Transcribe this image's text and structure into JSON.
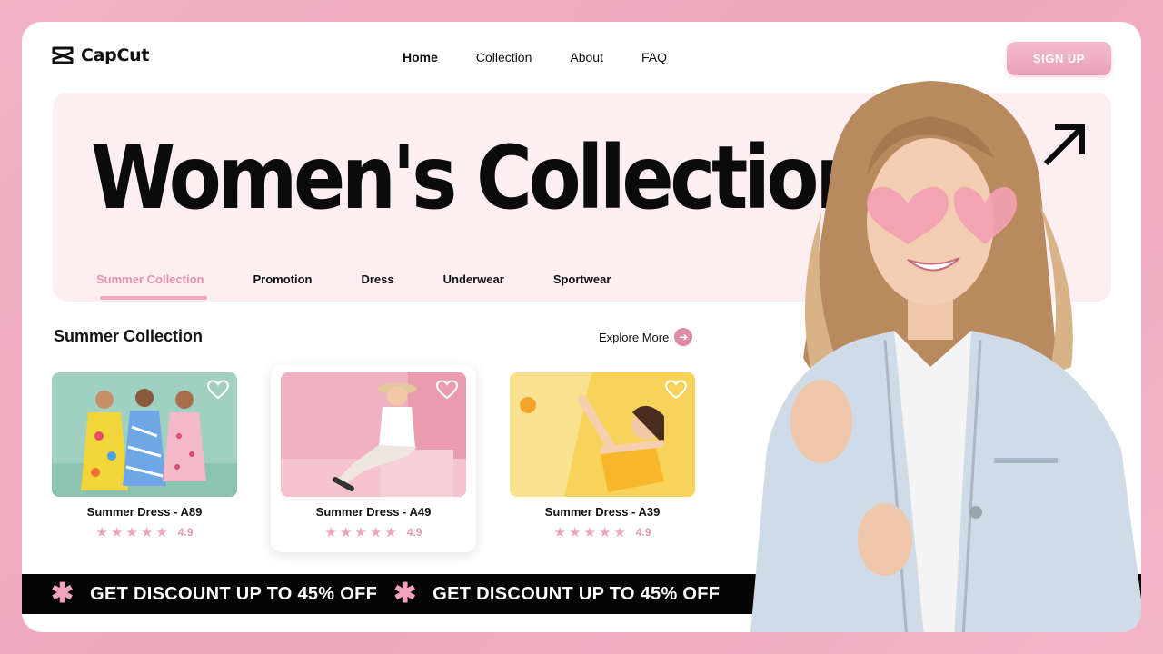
{
  "brand": {
    "name": "CapCut"
  },
  "nav": {
    "items": [
      {
        "label": "Home",
        "active": true
      },
      {
        "label": "Collection",
        "active": false
      },
      {
        "label": "About",
        "active": false
      },
      {
        "label": "FAQ",
        "active": false
      }
    ],
    "signup_label": "SIGN UP"
  },
  "hero": {
    "title": "Women's Collection",
    "arrow_icon": "arrow-up-right-icon",
    "tabs": [
      {
        "label": "Summer Collection",
        "active": true
      },
      {
        "label": "Promotion",
        "active": false
      },
      {
        "label": "Dress",
        "active": false
      },
      {
        "label": "Underwear",
        "active": false
      },
      {
        "label": "Sportwear",
        "active": false
      }
    ]
  },
  "section": {
    "title": "Summer Collection",
    "explore_label": "Explore More"
  },
  "products": [
    {
      "name": "Summer Dress - A89",
      "stars": 5,
      "rating": "4.9",
      "featured": false
    },
    {
      "name": "Summer Dress - A49",
      "stars": 5,
      "rating": "4.9",
      "featured": true
    },
    {
      "name": "Summer Dress - A39",
      "stars": 5,
      "rating": "4.9",
      "featured": false
    }
  ],
  "banner": {
    "text": "GET DISCOUNT UP TO 45% OFF"
  },
  "colors": {
    "accent_pink": "#eea5bb",
    "hero_bg": "#fdeef2",
    "background": "#eea7bd",
    "banner_bg": "#050505"
  }
}
